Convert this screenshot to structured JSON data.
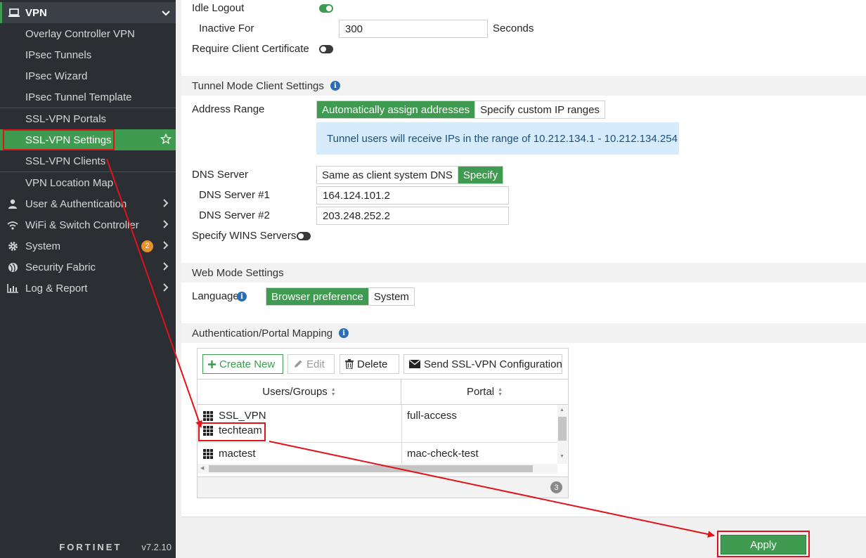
{
  "sidebar": {
    "section_title": "VPN",
    "vpn_items": [
      "Overlay Controller VPN",
      "IPsec Tunnels",
      "IPsec Wizard",
      "IPsec Tunnel Template",
      "SSL-VPN Portals",
      "SSL-VPN Settings",
      "SSL-VPN Clients",
      "VPN Location Map"
    ],
    "nav_items": [
      {
        "label": "User & Authentication",
        "icon": "user-icon"
      },
      {
        "label": "WiFi & Switch Controller",
        "icon": "wifi-icon"
      },
      {
        "label": "System",
        "icon": "gear-icon",
        "badge": "2"
      },
      {
        "label": "Security Fabric",
        "icon": "fabric-icon"
      },
      {
        "label": "Log & Report",
        "icon": "chart-icon"
      }
    ],
    "logo": "FORTINET",
    "version": "v7.2.10"
  },
  "form": {
    "idle_logout_label": "Idle Logout",
    "inactive_for_label": "Inactive For",
    "inactive_for_value": "300",
    "seconds_label": "Seconds",
    "require_cert_label": "Require Client Certificate",
    "tunnel_section": "Tunnel Mode Client Settings",
    "address_range_label": "Address Range",
    "address_options": [
      "Automatically assign addresses",
      "Specify custom IP ranges"
    ],
    "tunnel_notice": "Tunnel users will receive IPs in the range of 10.212.134.1 - 10.212.134.254",
    "dns_server_label": "DNS Server",
    "dns_options": [
      "Same as client system DNS",
      "Specify"
    ],
    "dns1_label": "DNS Server #1",
    "dns1_value": "164.124.101.2",
    "dns2_label": "DNS Server #2",
    "dns2_value": "203.248.252.2",
    "wins_label": "Specify WINS Servers",
    "web_section": "Web Mode Settings",
    "language_label": "Language",
    "language_options": [
      "Browser preference",
      "System"
    ],
    "auth_section": "Authentication/Portal Mapping"
  },
  "table": {
    "toolbar": {
      "create": "Create New",
      "edit": "Edit",
      "delete": "Delete",
      "send": "Send SSL-VPN Configuration"
    },
    "columns": [
      "Users/Groups",
      "Portal"
    ],
    "rows": [
      {
        "groups": [
          "SSL_VPN",
          "techteam"
        ],
        "portal": "full-access"
      },
      {
        "groups": [
          "mactest"
        ],
        "portal": "mac-check-test"
      }
    ],
    "count": "3"
  },
  "apply_label": "Apply",
  "colors": {
    "accent": "#3e9b4f",
    "annotation": "#e0131a",
    "sidebar": "#2b2f33"
  }
}
